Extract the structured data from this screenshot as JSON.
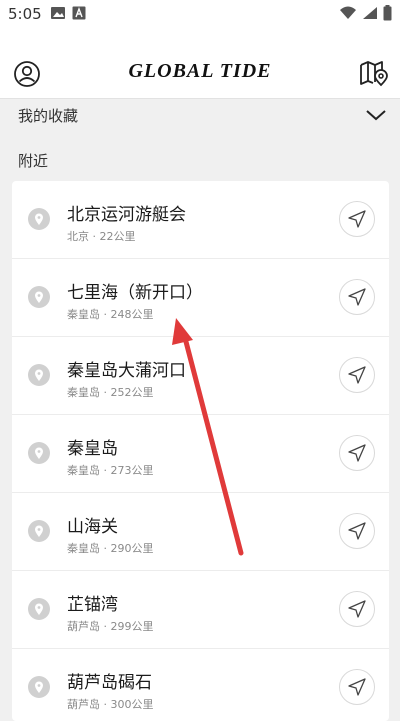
{
  "status_bar": {
    "time": "5:05",
    "icons": [
      "image-icon",
      "text-a-icon",
      "wifi-icon",
      "signal-icon",
      "battery-icon"
    ]
  },
  "header": {
    "brand": "GLOBAL  TIDE",
    "left_icon": "profile-icon",
    "right_icon": "map-pin-icon"
  },
  "favorites": {
    "label": "我的收藏",
    "state": "collapsed"
  },
  "nearby": {
    "label": "附近",
    "items": [
      {
        "name": "北京运河游艇会",
        "meta": "北京 · 22公里"
      },
      {
        "name": "七里海（新开口）",
        "meta": "秦皇岛 · 248公里"
      },
      {
        "name": "秦皇岛大蒲河口",
        "meta": "秦皇岛 · 252公里"
      },
      {
        "name": "秦皇岛",
        "meta": "秦皇岛 · 273公里"
      },
      {
        "name": "山海关",
        "meta": "秦皇岛 · 290公里"
      },
      {
        "name": "芷锚湾",
        "meta": "葫芦岛 · 299公里"
      },
      {
        "name": "葫芦岛碣石",
        "meta": "葫芦岛 · 300公里"
      }
    ]
  },
  "colors": {
    "background": "#f0f0f0",
    "card": "#ffffff",
    "annotation_arrow": "#e03a3a",
    "pin": "#c8c8c8"
  }
}
